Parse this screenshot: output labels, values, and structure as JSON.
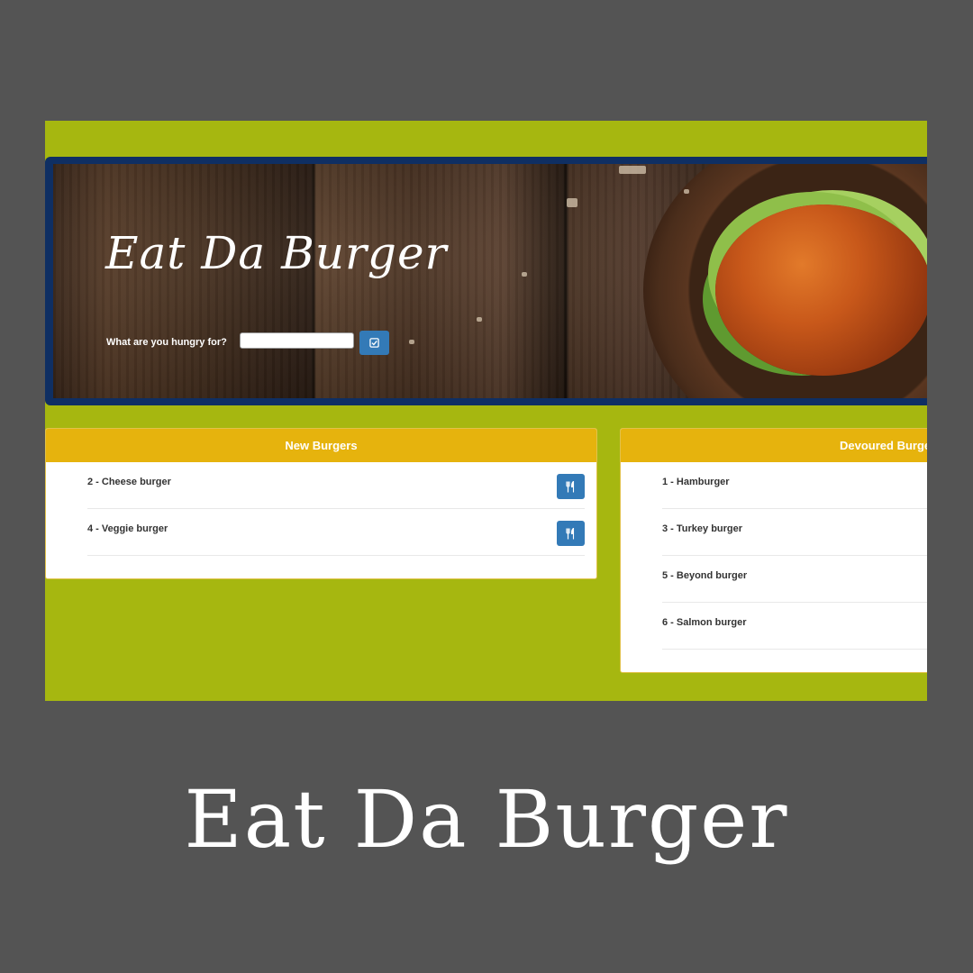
{
  "app": {
    "title": "Eat Da Burger",
    "hungry_label": "What are you hungry for?",
    "input_value": "",
    "submit_icon": "check-square-icon"
  },
  "new_burgers": {
    "heading": "New Burgers",
    "action_icon": "utensils-icon",
    "items": [
      {
        "label": "2 - Cheese burger"
      },
      {
        "label": "4 - Veggie burger"
      }
    ]
  },
  "devoured_burgers": {
    "heading": "Devoured Burgers",
    "items": [
      {
        "label": "1 - Hamburger"
      },
      {
        "label": "3 - Turkey burger"
      },
      {
        "label": "5 - Beyond burger"
      },
      {
        "label": "6 - Salmon burger"
      }
    ]
  },
  "caption": "Eat Da Burger",
  "colors": {
    "background": "#545454",
    "page_bg": "#a6b710",
    "jumbotron_border": "#0f2f63",
    "panel_heading": "#e6b30d",
    "button": "#337ab7"
  }
}
